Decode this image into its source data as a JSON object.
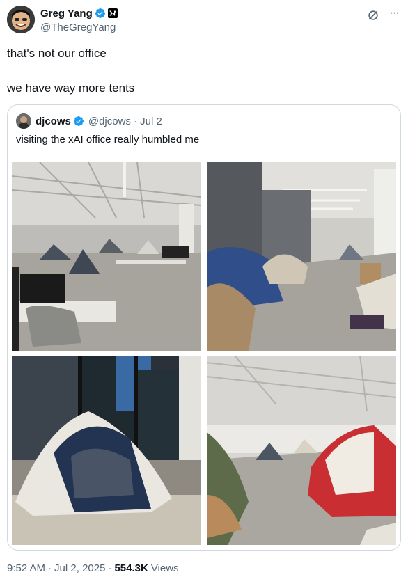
{
  "author": {
    "display_name": "Greg Yang",
    "handle": "@TheGregYang",
    "verified": true,
    "affiliation_badge": "xAI"
  },
  "tweet": {
    "lines": [
      "that's not our office",
      "we have way more tents"
    ]
  },
  "quoted": {
    "display_name": "djcows",
    "handle": "@djcows",
    "date": "· Jul 2",
    "verified": true,
    "text": "visiting the xAI office really humbled me",
    "images": [
      "office-tents-photo-1",
      "office-tents-photo-2",
      "office-tents-photo-3",
      "office-tents-photo-4"
    ]
  },
  "meta": {
    "time": "9:52 AM",
    "date": "Jul 2, 2025",
    "views_count": "554.3K",
    "views_label": "Views"
  },
  "colors": {
    "verified_blue": "#1d9bf0",
    "text_primary": "#0f1419",
    "text_secondary": "#536471",
    "border": "#cfd9de"
  },
  "icons": [
    "verified-badge-icon",
    "xai-affiliation-icon",
    "grok-icon",
    "more-options-icon"
  ]
}
